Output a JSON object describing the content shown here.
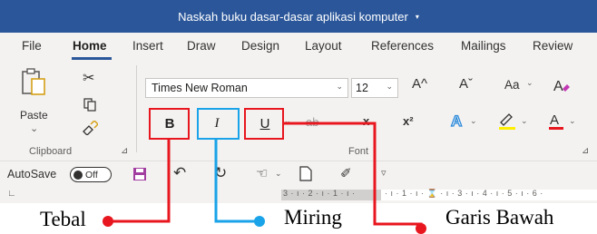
{
  "window": {
    "title": "Naskah buku dasar-dasar aplikasi komputer",
    "title_caret": "▾"
  },
  "tabs": [
    "File",
    "Home",
    "Insert",
    "Draw",
    "Design",
    "Layout",
    "References",
    "Mailings",
    "Review"
  ],
  "active_tab": "Home",
  "clipboard": {
    "paste_label": "Paste",
    "paste_caret": "⌄",
    "group_label": "Clipboard"
  },
  "font": {
    "font_name": "Times New Roman",
    "font_size": "12",
    "grow_label": "A^",
    "shrink_label": "Aˇ",
    "case_label": "Aa",
    "bold_label": "B",
    "italic_label": "I",
    "underline_label": "U",
    "strike_label": "ab",
    "subscript_label": "x",
    "superscript_label": "x²",
    "color_label": "A",
    "group_label": "Font"
  },
  "qat": {
    "autosave_label": "AutoSave",
    "autosave_state": "Off"
  },
  "ruler": {
    "left_marks": "3 · ı · 2 · ı · 1 · ı ·",
    "right_marks": "· ı · 1 · ı · ⌛ · ı · 3 · ı · 4 · ı · 5 · ı · 6 ·"
  },
  "annotations": {
    "bold": "Tebal",
    "italic": "Miring",
    "underline": "Garis Bawah"
  },
  "colors": {
    "title_bg": "#2b579a",
    "ribbon_bg": "#f3f2f1",
    "highlight_red": "#e8161e",
    "highlight_blue": "#1aa3e8",
    "font_color_bar": "#e8161e",
    "highlighter_bar": "#ffee00"
  }
}
